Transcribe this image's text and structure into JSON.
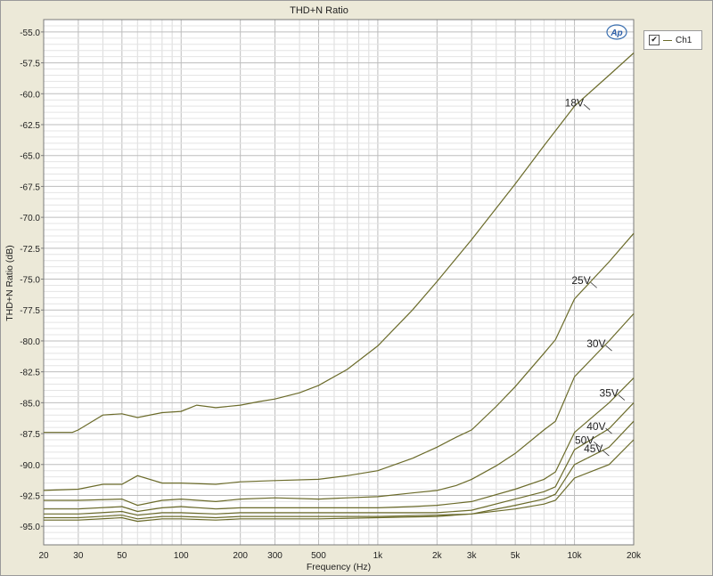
{
  "chart_data": {
    "type": "line",
    "title": "THD+N Ratio",
    "xlabel": "Frequency (Hz)",
    "ylabel": "THD+N Ratio (dB)",
    "xscale": "log",
    "xlim": [
      20,
      20000
    ],
    "ylim": [
      -96.5,
      -54
    ],
    "grid": true,
    "x_ticks": [
      {
        "v": 20,
        "label": "20"
      },
      {
        "v": 30,
        "label": "30"
      },
      {
        "v": 50,
        "label": "50"
      },
      {
        "v": 100,
        "label": "100"
      },
      {
        "v": 200,
        "label": "200"
      },
      {
        "v": 300,
        "label": "300"
      },
      {
        "v": 500,
        "label": "500"
      },
      {
        "v": 1000,
        "label": "1k"
      },
      {
        "v": 2000,
        "label": "2k"
      },
      {
        "v": 3000,
        "label": "3k"
      },
      {
        "v": 5000,
        "label": "5k"
      },
      {
        "v": 10000,
        "label": "10k"
      },
      {
        "v": 20000,
        "label": "20k"
      }
    ],
    "y_ticks": [
      {
        "v": -55,
        "label": "-55.0"
      },
      {
        "v": -57.5,
        "label": "-57.5"
      },
      {
        "v": -60,
        "label": "-60.0"
      },
      {
        "v": -62.5,
        "label": "-62.5"
      },
      {
        "v": -65,
        "label": "-65.0"
      },
      {
        "v": -67.5,
        "label": "-67.5"
      },
      {
        "v": -70,
        "label": "-70.0"
      },
      {
        "v": -72.5,
        "label": "-72.5"
      },
      {
        "v": -75,
        "label": "-75.0"
      },
      {
        "v": -77.5,
        "label": "-77.5"
      },
      {
        "v": -80,
        "label": "-80.0"
      },
      {
        "v": -82.5,
        "label": "-82.5"
      },
      {
        "v": -85,
        "label": "-85.0"
      },
      {
        "v": -87.5,
        "label": "-87.5"
      },
      {
        "v": -90,
        "label": "-90.0"
      },
      {
        "v": -92.5,
        "label": "-92.5"
      },
      {
        "v": -95,
        "label": "-95.0"
      }
    ],
    "line_color": "#6B6B2A",
    "series": [
      {
        "name": "18V",
        "x": [
          20,
          28,
          30,
          40,
          50,
          60,
          80,
          100,
          120,
          150,
          200,
          250,
          300,
          400,
          500,
          700,
          1000,
          1500,
          2000,
          3000,
          5000,
          7000,
          10000,
          15000,
          20000
        ],
        "y": [
          -87.4,
          -87.4,
          -87.2,
          -86.0,
          -85.9,
          -86.2,
          -85.8,
          -85.7,
          -85.2,
          -85.4,
          -85.2,
          -84.9,
          -84.7,
          -84.2,
          -83.6,
          -82.3,
          -80.4,
          -77.5,
          -75.2,
          -71.8,
          -67.3,
          -64.2,
          -61.0,
          -58.5,
          -56.7
        ],
        "label_pos": {
          "x": 12000,
          "y": -61.3
        }
      },
      {
        "name": "25V",
        "x": [
          20,
          30,
          40,
          50,
          60,
          80,
          100,
          150,
          200,
          300,
          500,
          700,
          1000,
          1500,
          2000,
          2500,
          3000,
          4000,
          5000,
          7000,
          8000,
          10000,
          15000,
          20000
        ],
        "y": [
          -92.1,
          -92.0,
          -91.6,
          -91.6,
          -90.9,
          -91.5,
          -91.5,
          -91.6,
          -91.4,
          -91.3,
          -91.2,
          -90.9,
          -90.5,
          -89.5,
          -88.6,
          -87.8,
          -87.2,
          -85.3,
          -83.7,
          -81.0,
          -79.9,
          -76.6,
          -73.6,
          -71.3
        ],
        "label_pos": {
          "x": 13000,
          "y": -75.7
        }
      },
      {
        "name": "30V",
        "x": [
          20,
          30,
          50,
          60,
          80,
          100,
          150,
          200,
          300,
          500,
          700,
          1000,
          1500,
          2000,
          2500,
          3000,
          4000,
          5000,
          7000,
          8000,
          10000,
          15000,
          20000
        ],
        "y": [
          -92.9,
          -92.9,
          -92.8,
          -93.3,
          -92.9,
          -92.8,
          -93.0,
          -92.8,
          -92.7,
          -92.8,
          -92.7,
          -92.6,
          -92.3,
          -92.1,
          -91.7,
          -91.2,
          -90.1,
          -89.1,
          -87.2,
          -86.5,
          -82.9,
          -80.0,
          -77.8
        ],
        "label_pos": {
          "x": 15500,
          "y": -80.8
        }
      },
      {
        "name": "35V",
        "x": [
          20,
          30,
          50,
          60,
          80,
          100,
          150,
          200,
          300,
          500,
          700,
          1000,
          1500,
          2000,
          3000,
          5000,
          7000,
          8000,
          10000,
          15000,
          20000
        ],
        "y": [
          -93.6,
          -93.6,
          -93.4,
          -93.8,
          -93.5,
          -93.4,
          -93.6,
          -93.5,
          -93.5,
          -93.5,
          -93.5,
          -93.5,
          -93.4,
          -93.3,
          -93.0,
          -92.0,
          -91.2,
          -90.6,
          -87.4,
          -85.0,
          -83.0
        ],
        "label_pos": {
          "x": 18000,
          "y": -84.8
        }
      },
      {
        "name": "40V",
        "x": [
          20,
          30,
          50,
          60,
          80,
          100,
          150,
          200,
          300,
          500,
          1000,
          2000,
          3000,
          5000,
          7000,
          8000,
          10000,
          15000,
          20000
        ],
        "y": [
          -94.0,
          -94.0,
          -93.8,
          -94.1,
          -93.9,
          -93.9,
          -94.0,
          -93.9,
          -93.9,
          -93.9,
          -93.9,
          -93.9,
          -93.7,
          -92.8,
          -92.2,
          -91.8,
          -88.8,
          -87.1,
          -85.0
        ],
        "label_pos": {
          "x": 15500,
          "y": -87.5
        }
      },
      {
        "name": "45V",
        "x": [
          20,
          30,
          50,
          60,
          80,
          100,
          150,
          200,
          300,
          500,
          1000,
          2000,
          3000,
          5000,
          7000,
          8000,
          10000,
          15000,
          20000
        ],
        "y": [
          -94.3,
          -94.3,
          -94.1,
          -94.4,
          -94.2,
          -94.2,
          -94.3,
          -94.2,
          -94.2,
          -94.2,
          -94.2,
          -94.1,
          -94.0,
          -93.3,
          -92.8,
          -92.4,
          -90.0,
          -88.6,
          -86.5
        ],
        "label_pos": {
          "x": 15000,
          "y": -89.3
        }
      },
      {
        "name": "50V",
        "x": [
          20,
          30,
          50,
          60,
          80,
          100,
          150,
          200,
          300,
          500,
          1000,
          2000,
          3000,
          5000,
          7000,
          8000,
          10000,
          15000,
          20000
        ],
        "y": [
          -94.5,
          -94.5,
          -94.3,
          -94.6,
          -94.4,
          -94.4,
          -94.5,
          -94.4,
          -94.4,
          -94.4,
          -94.3,
          -94.2,
          -94.0,
          -93.6,
          -93.2,
          -92.9,
          -91.1,
          -90.0,
          -88.0
        ],
        "label_pos": {
          "x": 13500,
          "y": -88.6
        }
      }
    ],
    "legend": {
      "position": "top-right",
      "entries": [
        {
          "label": "Ch1",
          "checked": true
        }
      ]
    }
  },
  "chart_title": "THD+N Ratio",
  "x_axis_title": "Frequency (Hz)",
  "y_axis_title": "THD+N Ratio (dB)",
  "legend_label": "Ch1",
  "legend_check": "✔",
  "logo_text": "AP"
}
